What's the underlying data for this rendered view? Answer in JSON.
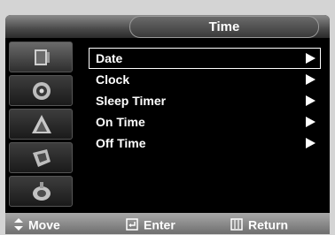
{
  "window": {
    "title": "Time"
  },
  "menu": {
    "items": [
      {
        "label": "Date",
        "selected": true
      },
      {
        "label": "Clock",
        "selected": false
      },
      {
        "label": "Sleep Timer",
        "selected": false
      },
      {
        "label": "On Time",
        "selected": false
      },
      {
        "label": "Off Time",
        "selected": false
      }
    ]
  },
  "sidebar": {
    "icons": [
      "picture-icon",
      "sound-icon",
      "channel-icon",
      "setup-icon",
      "input-icon"
    ],
    "active_index": 0
  },
  "footer": {
    "move_label": "Move",
    "enter_label": "Enter",
    "return_label": "Return"
  },
  "colors": {
    "background": "#000000",
    "text": "#ffffff",
    "footer": "#8c8c8c"
  }
}
